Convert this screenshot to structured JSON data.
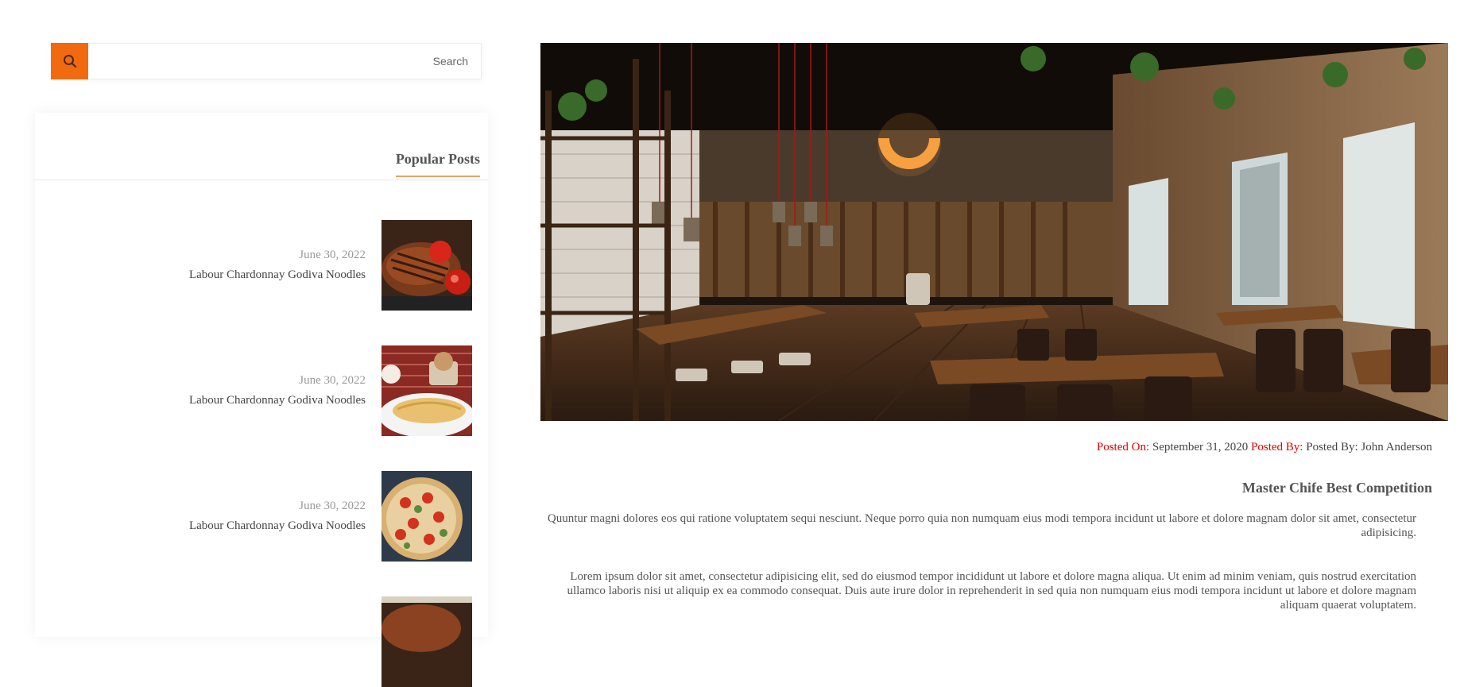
{
  "search": {
    "placeholder": "Search",
    "icon": "search-icon",
    "accent": "#f26a0f"
  },
  "popular": {
    "title": "Popular Posts",
    "posts": [
      {
        "date": "June 30, 2022",
        "title": "Labour Chardonnay Godiva Noodles"
      },
      {
        "date": "June 30, 2022",
        "title": "Labour Chardonnay Godiva Noodles"
      },
      {
        "date": "June 30, 2022",
        "title": "Labour Chardonnay Godiva Noodles"
      },
      {
        "date": "",
        "title": ""
      }
    ]
  },
  "article": {
    "posted_on_label": "Posted On:",
    "posted_on_value": "September 31, 2020",
    "posted_by_label": "Posted By:",
    "posted_by_value": "Posted By: John Anderson",
    "title": "Master Chife Best Competition",
    "paragraphs": [
      "Quuntur magni dolores eos qui ratione voluptatem sequi nesciunt. Neque porro quia non numquam eius modi tempora incidunt ut labore et dolore magnam dolor sit amet, consectetur adipisicing.",
      "Lorem ipsum dolor sit amet, consectetur adipisicing elit, sed do eiusmod tempor incididunt ut labore et dolore magna aliqua. Ut enim ad minim veniam, quis nostrud exercitation ullamco laboris nisi ut aliquip ex ea commodo consequat. Duis aute irure dolor in reprehenderit in sed quia non numquam eius modi tempora incidunt ut labore et dolore magnam aliquam quaerat voluptatem."
    ],
    "label_color": "#e00000"
  }
}
